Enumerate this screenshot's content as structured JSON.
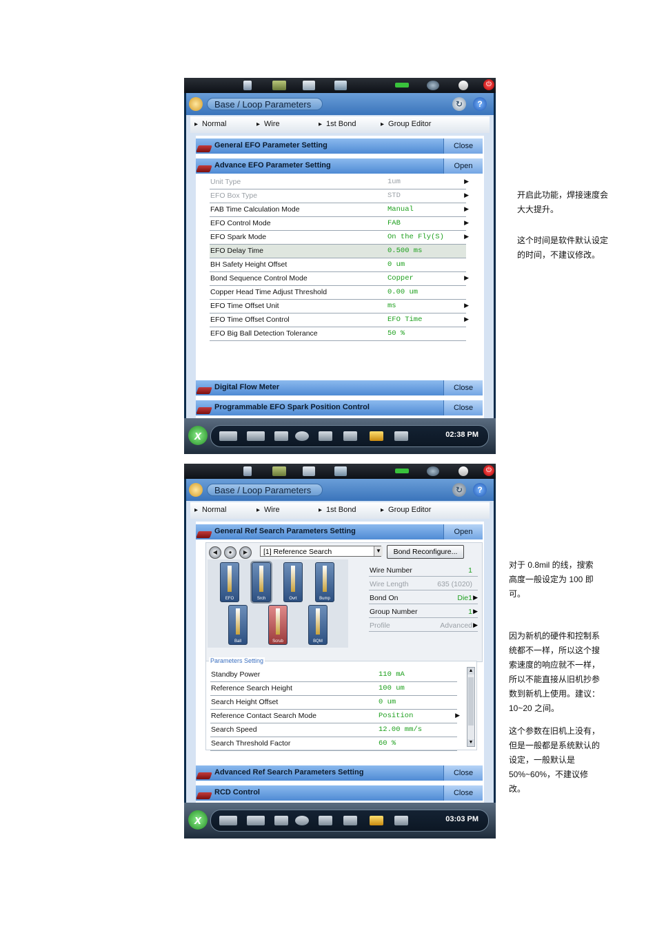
{
  "screen1": {
    "title": "Base / Loop Parameters",
    "breadcrumb": [
      "Normal",
      "Wire",
      "1st Bond",
      "Group Editor"
    ],
    "sections": [
      {
        "title": "General EFO Parameter Setting",
        "action": "Close"
      },
      {
        "title": "Advance EFO Parameter Setting",
        "action": "Open"
      },
      {
        "title": "Digital Flow Meter",
        "action": "Close"
      },
      {
        "title": "Programmable EFO Spark Position Control",
        "action": "Close"
      }
    ],
    "rows": [
      {
        "label": "Unit Type",
        "value": "1um",
        "arrow": "▶"
      },
      {
        "label": "EFO Box Type",
        "value": "STD",
        "arrow": "▶"
      },
      {
        "label": "FAB Time Calculation Mode",
        "value": "Manual",
        "arrow": "▶"
      },
      {
        "label": "EFO Control Mode",
        "value": "FAB",
        "arrow": "▶"
      },
      {
        "label": "EFO Spark Mode",
        "value": "On the Fly(S)",
        "arrow": "▶"
      },
      {
        "label": "EFO Delay Time",
        "value": "0.500 ms",
        "arrow": ""
      },
      {
        "label": "BH Safety Height Offset",
        "value": "0 um",
        "arrow": ""
      },
      {
        "label": "Bond Sequence Control Mode",
        "value": "Copper",
        "arrow": "▶"
      },
      {
        "label": "Copper Head Time Adjust Threshold",
        "value": "0.00 um",
        "arrow": ""
      },
      {
        "label": "EFO Time Offset Unit",
        "value": "ms",
        "arrow": "▶"
      },
      {
        "label": "EFO Time Offset Control",
        "value": "EFO Time",
        "arrow": "▶"
      },
      {
        "label": "EFO Big Ball Detection Tolerance",
        "value": "50 %",
        "arrow": ""
      }
    ],
    "clock": "02:38 PM"
  },
  "screen2": {
    "title": "Base / Loop Parameters",
    "breadcrumb": [
      "Normal",
      "Wire",
      "1st Bond",
      "Group Editor"
    ],
    "sections": [
      {
        "title": "General Ref Search Parameters Setting",
        "action": "Open"
      },
      {
        "title": "Advanced Ref Search Parameters Setting",
        "action": "Close"
      },
      {
        "title": "RCD Control",
        "action": "Close"
      }
    ],
    "select_value": "[1] Reference Search",
    "reconfigure_label": "Bond Reconfigure...",
    "tools": [
      "EFO",
      "Srch",
      "Ovrt",
      "Bump",
      "Ball",
      "Scrub",
      "BQM"
    ],
    "info": [
      {
        "label": "Wire Number",
        "value": "1",
        "arrow": ""
      },
      {
        "label": "Wire Length",
        "value": "635 (1020)",
        "arrow": ""
      },
      {
        "label": "Bond On",
        "value": "Die1",
        "arrow": "▶"
      },
      {
        "label": "Group Number",
        "value": "1",
        "arrow": "▶"
      },
      {
        "label": "Profile",
        "value": "Advanced",
        "arrow": "▶"
      }
    ],
    "params_title": "Parameters Setting",
    "params": [
      {
        "label": "Standby Power",
        "value": "110 mA",
        "arrow": ""
      },
      {
        "label": "Reference Search Height",
        "value": "100 um",
        "arrow": ""
      },
      {
        "label": "Search Height Offset",
        "value": "0 um",
        "arrow": ""
      },
      {
        "label": "Reference Contact Search Mode",
        "value": "Position",
        "arrow": "▶"
      },
      {
        "label": "Search Speed",
        "value": "12.00 mm/s",
        "arrow": ""
      },
      {
        "label": "Search Threshold Factor",
        "value": "60 %",
        "arrow": ""
      }
    ],
    "clock": "03:03 PM"
  },
  "notes": [
    "开启此功能，焊接速度会",
    "大大提升。",
    "这个时间是软件默认设定",
    "的时间，不建议修改。",
    "对于 0.8mil 的线，搜索",
    "高度一般设定为 100 即",
    "可。",
    "因为新机的硬件和控制系",
    "统都不一样，所以这个搜",
    "索速度的响应就不一样，",
    "所以不能直接从旧机抄参",
    "数到新机上使用。建议：",
    "10~20 之间。",
    "这个参数在旧机上没有，",
    "但是一般都是系统默认的",
    "设定，一般默认是",
    "50%~60%，不建议修",
    "改。"
  ]
}
